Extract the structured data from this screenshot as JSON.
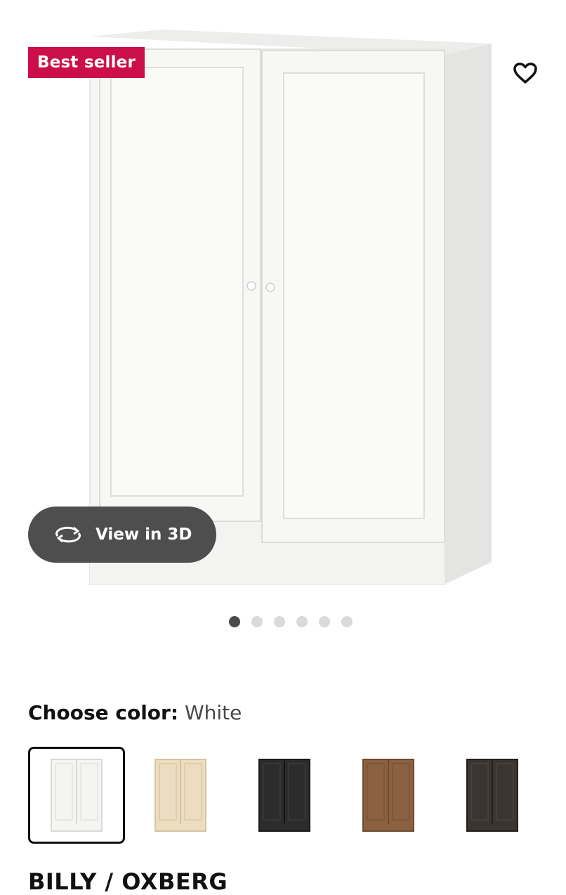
{
  "product": {
    "badge": "Best seller",
    "view3d_label": "View in 3D",
    "image_count": 6,
    "active_image": 1,
    "choose_color_label": "Choose color:",
    "selected_color": "White",
    "title": "BILLY / OXBERG"
  },
  "swatches": [
    {
      "name": "white",
      "hex": "#f4f4f2",
      "selected": true
    },
    {
      "name": "birch",
      "hex": "#ecdcc0",
      "selected": false
    },
    {
      "name": "black",
      "hex": "#2c2c2c",
      "selected": false
    },
    {
      "name": "brown-walnut",
      "hex": "#8b6142",
      "selected": false
    },
    {
      "name": "dark-brown",
      "hex": "#3b3430",
      "selected": false
    }
  ],
  "colors": {
    "badge_bg": "#cc0f4b",
    "pill_bg": "#4e4e4e",
    "dot_active": "#4a4a4a",
    "dot_inactive": "#dadada"
  },
  "icons": {
    "favorite": "heart-outline-icon",
    "view3d": "rotate-3d-icon"
  }
}
